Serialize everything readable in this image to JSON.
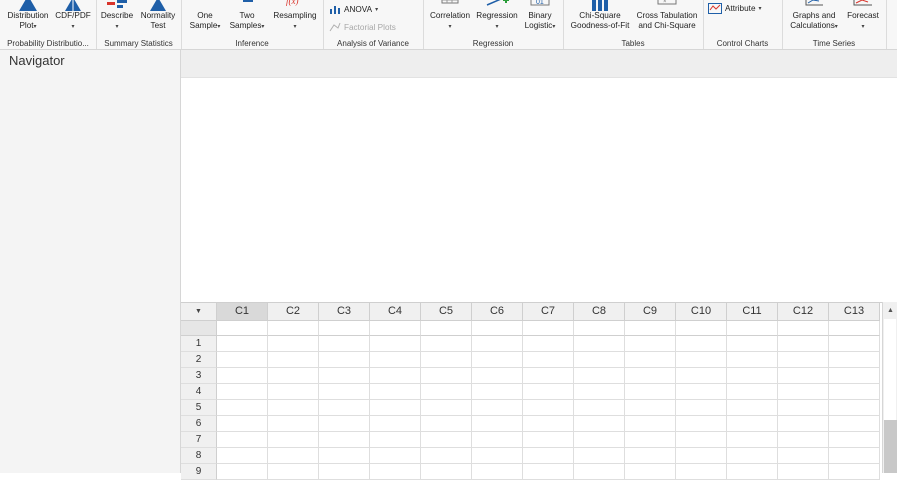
{
  "ribbon": {
    "groups": [
      {
        "label": "Probability Distributio...",
        "buttons": [
          {
            "l1": "Distribution",
            "l2": "Plot",
            "caret": true,
            "icon": "distribution-plot-icon"
          },
          {
            "l1": "CDF/PDF",
            "l2": "",
            "caret": true,
            "icon": "cdf-pdf-icon"
          }
        ]
      },
      {
        "label": "Summary Statistics",
        "buttons": [
          {
            "l1": "Describe",
            "l2": "",
            "caret": true,
            "icon": "describe-icon"
          },
          {
            "l1": "Normality",
            "l2": "Test",
            "caret": false,
            "icon": "normality-test-icon"
          }
        ]
      },
      {
        "label": "Inference",
        "buttons": [
          {
            "l1": "One",
            "l2": "Sample",
            "caret": true,
            "icon": "one-sample-icon"
          },
          {
            "l1": "Two",
            "l2": "Samples",
            "caret": true,
            "icon": "two-samples-icon"
          },
          {
            "l1": "Resampling",
            "l2": "",
            "caret": true,
            "icon": "resampling-icon"
          }
        ]
      },
      {
        "label": "Analysis of Variance",
        "anova": "ANOVA",
        "factorial": "Factorial Plots"
      },
      {
        "label": "Regression",
        "buttons": [
          {
            "l1": "Correlation",
            "l2": "",
            "caret": true,
            "icon": "correlation-icon"
          },
          {
            "l1": "Regression",
            "l2": "",
            "caret": true,
            "icon": "regression-icon"
          },
          {
            "l1": "Binary",
            "l2": "Logistic",
            "caret": true,
            "icon": "binary-logistic-icon"
          }
        ]
      },
      {
        "label": "Tables",
        "buttons": [
          {
            "l1": "Chi-Square",
            "l2": "Goodness-of-Fit",
            "caret": false,
            "icon": "chi-square-icon"
          },
          {
            "l1": "Cross Tabulation",
            "l2": "and Chi-Square",
            "caret": false,
            "icon": "cross-tabulation-icon"
          }
        ]
      },
      {
        "label": "Control Charts",
        "attribute": "Attribute"
      },
      {
        "label": "Time Series",
        "buttons": [
          {
            "l1": "Graphs and",
            "l2": "Calculations",
            "caret": true,
            "icon": "graphs-calculations-icon"
          },
          {
            "l1": "Forecast",
            "l2": "",
            "caret": true,
            "icon": "forecast-icon"
          }
        ]
      }
    ]
  },
  "navigator": {
    "title": "Navigator"
  },
  "worksheet": {
    "columns": [
      "C1",
      "C2",
      "C3",
      "C4",
      "C5",
      "C6",
      "C7",
      "C8",
      "C9",
      "C10",
      "C11",
      "C12",
      "C13"
    ],
    "rows": [
      "1",
      "2",
      "3",
      "4",
      "5",
      "6",
      "7",
      "8",
      "9"
    ],
    "corner_glyph": "▼",
    "scroll_up_glyph": "▲"
  },
  "colors": {
    "accent": "#1f5fa8",
    "red": "#d9342b",
    "ribbon_bg": "#f7f7f7"
  }
}
